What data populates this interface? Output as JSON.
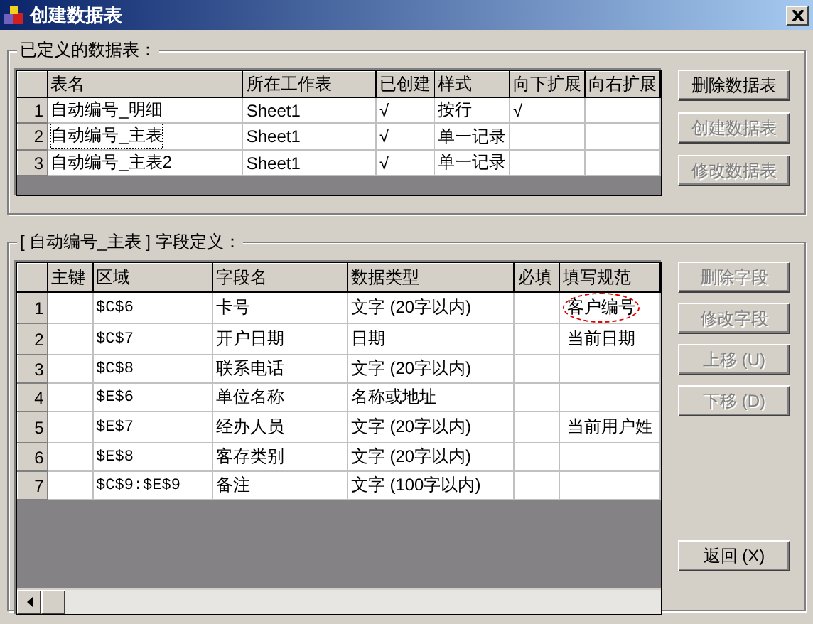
{
  "window": {
    "title": "创建数据表"
  },
  "tables_group": {
    "title": "已定义的数据表：",
    "columns": [
      "表名",
      "所在工作表",
      "已创建",
      "样式",
      "向下扩展",
      "向右扩展"
    ],
    "rows": [
      {
        "index": "1",
        "name": "自动编号_明细",
        "sheet": "Sheet1",
        "created": "√",
        "style": "按行",
        "expand_down": "√",
        "expand_right": "",
        "focused": false
      },
      {
        "index": "2",
        "name": "自动编号_主表",
        "sheet": "Sheet1",
        "created": "√",
        "style": "单一记录",
        "expand_down": "",
        "expand_right": "",
        "focused": true
      },
      {
        "index": "3",
        "name": "自动编号_主表2",
        "sheet": "Sheet1",
        "created": "√",
        "style": "单一记录",
        "expand_down": "",
        "expand_right": "",
        "focused": false
      }
    ],
    "buttons": [
      {
        "label": "删除数据表",
        "disabled": false
      },
      {
        "label": "创建数据表",
        "disabled": true
      },
      {
        "label": "修改数据表",
        "disabled": true
      }
    ]
  },
  "fields_group": {
    "title": "[ 自动编号_主表 ] 字段定义：",
    "columns": [
      "主键",
      "区域",
      "字段名",
      "数据类型",
      "必填",
      "填写规范"
    ],
    "rows": [
      {
        "index": "1",
        "range": "$C$6",
        "field": "卡号",
        "type": "文字 (20字以内)",
        "rule": "客户编号",
        "circled": true
      },
      {
        "index": "2",
        "range": "$C$7",
        "field": "开户日期",
        "type": "日期",
        "rule": "当前日期",
        "circled": false
      },
      {
        "index": "3",
        "range": "$C$8",
        "field": "联系电话",
        "type": "文字 (20字以内)",
        "rule": "",
        "circled": false
      },
      {
        "index": "4",
        "range": "$E$6",
        "field": "单位名称",
        "type": "名称或地址",
        "rule": "",
        "circled": false
      },
      {
        "index": "5",
        "range": "$E$7",
        "field": "经办人员",
        "type": "文字 (20字以内)",
        "rule": "当前用户姓",
        "circled": false
      },
      {
        "index": "6",
        "range": "$E$8",
        "field": "客存类别",
        "type": "文字 (20字以内)",
        "rule": "",
        "circled": false
      },
      {
        "index": "7",
        "range": "$C$9:$E$9",
        "field": "备注",
        "type": "文字 (100字以内)",
        "rule": "",
        "circled": false
      }
    ],
    "buttons": [
      {
        "label": "删除字段",
        "disabled": true
      },
      {
        "label": "修改字段",
        "disabled": true
      },
      {
        "label": "上移 (U)",
        "disabled": true
      },
      {
        "label": "下移 (D)",
        "disabled": true
      }
    ],
    "return_button": {
      "label": "返回 (X)",
      "disabled": false
    }
  }
}
